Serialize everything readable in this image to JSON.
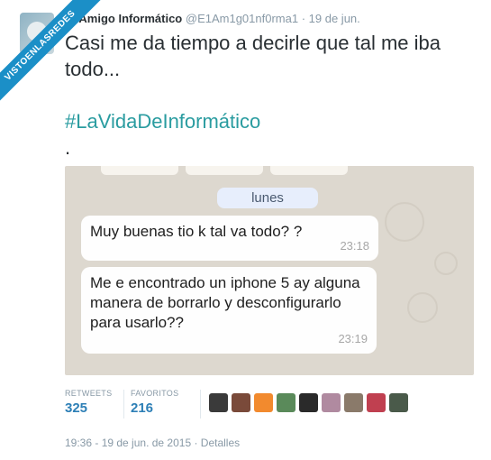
{
  "watermark": "VISTOENLASREDES",
  "tweet": {
    "author_name": "El Amigo Informático",
    "author_handle": "@E1Am1g01nf0rma1",
    "date_short": "· 19 de jun.",
    "text_line1": "Casi me da tiempo a decirle que tal me iba todo...",
    "hashtag": "#LaVidaDeInformático",
    "dot": "."
  },
  "chat": {
    "date_label": "lunes",
    "messages": [
      {
        "text": "Muy buenas tio k tal va todo? ?",
        "time": "23:18"
      },
      {
        "text": "Me e encontrado un iphone 5 ay alguna manera de borrarlo y desconfigurarlo para usarlo??",
        "time": "23:19"
      }
    ]
  },
  "stats": {
    "retweets_label": "RETWEETS",
    "retweets_value": "325",
    "favorites_label": "FAVORITOS",
    "favorites_value": "216"
  },
  "favorited_by": [
    {
      "icon": "user-avatar-1",
      "color": "#3a3a3a"
    },
    {
      "icon": "user-avatar-2",
      "color": "#7a4a3a"
    },
    {
      "icon": "user-avatar-3",
      "color": "#f28a2e"
    },
    {
      "icon": "user-avatar-4",
      "color": "#5a8a5a"
    },
    {
      "icon": "user-avatar-5",
      "color": "#2a2a2a"
    },
    {
      "icon": "user-avatar-6",
      "color": "#b08aa0"
    },
    {
      "icon": "user-avatar-7",
      "color": "#8a7a6a"
    },
    {
      "icon": "user-avatar-8",
      "color": "#c04050"
    },
    {
      "icon": "user-avatar-9",
      "color": "#4a5a4a"
    }
  ],
  "footer": "19:36 - 19 de jun. de 2015 · Detalles"
}
